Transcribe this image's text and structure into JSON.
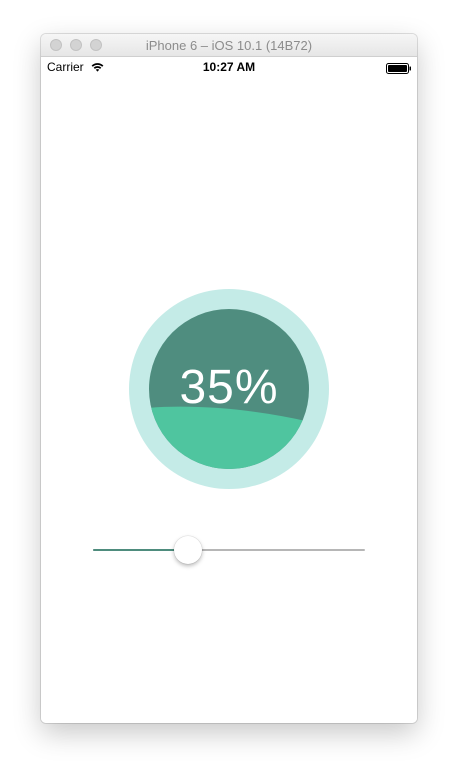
{
  "window": {
    "title": "iPhone 6 – iOS 10.1 (14B72)"
  },
  "status_bar": {
    "carrier": "Carrier",
    "time": "10:27 AM",
    "icons": [
      "wifi-icon",
      "battery-icon"
    ]
  },
  "gauge": {
    "label": "35%",
    "value_fraction": 0.35,
    "colors": {
      "ring": "#c4ebe7",
      "upper_fill": "#4f8d7f",
      "wave_fill": "#4fc59f",
      "text": "#ffffff"
    }
  },
  "slider": {
    "value_fraction": 0.35,
    "colors": {
      "min_track": "#4e8c7d",
      "max_track": "#b6b6b6",
      "thumb": "#ffffff"
    }
  }
}
